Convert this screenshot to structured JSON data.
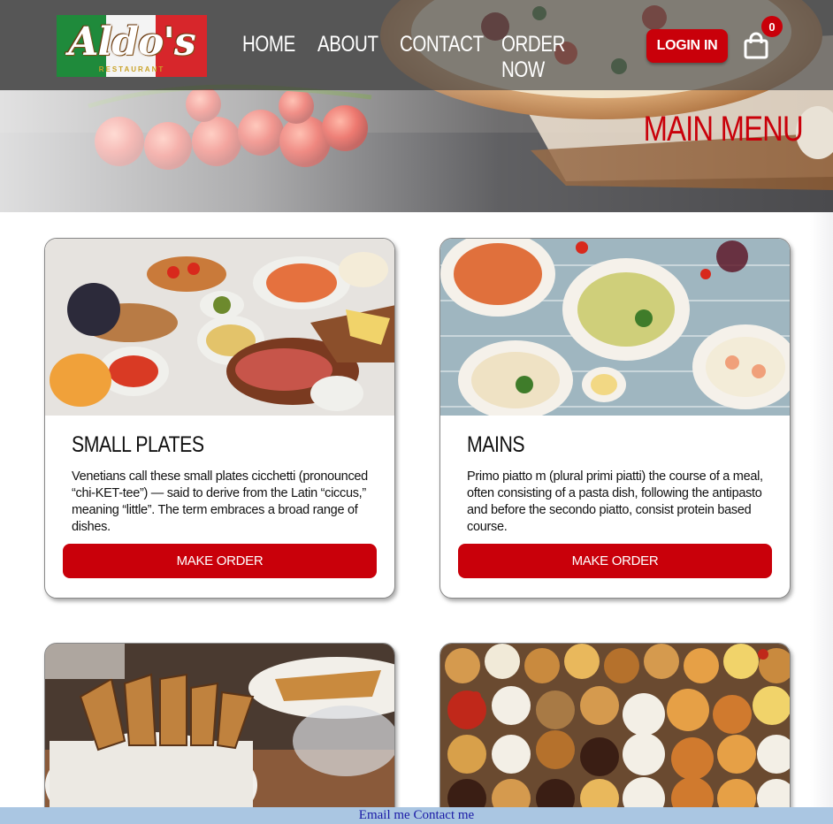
{
  "brand": {
    "logo_text": "Aldo's",
    "logo_subtitle": "RESTAURANT"
  },
  "nav": {
    "items": [
      "HOME",
      "ABOUT",
      "CONTACT",
      "ORDER NOW"
    ],
    "login_label": "LOGIN IN",
    "cart_count": "0"
  },
  "hero": {
    "title": "MAIN MENU"
  },
  "menu": {
    "cards": [
      {
        "title": "SMALL PLATES",
        "description": "Venetians call these small plates cicchetti (pronounced “chi-KET-tee”) — said to derive from the Latin “ciccus,” meaning “little”. The term embraces a broad range of dishes.",
        "button_label": "MAKE ORDER"
      },
      {
        "title": "MAINS",
        "description": "Primo piatto m (plural primi piatti) the course of a meal, often consisting of a pasta dish, following the antipasto and before the secondo piatto, consist protein based course.",
        "button_label": "MAKE ORDER"
      },
      {
        "title": "",
        "description": "",
        "button_label": ""
      },
      {
        "title": "",
        "description": "",
        "button_label": ""
      }
    ]
  },
  "footer": {
    "email_link": "Email me",
    "contact_link": "Contact me"
  },
  "colors": {
    "brand_red": "#c9000a",
    "nav_overlay": "#555555",
    "footer_bg": "#aac6e2",
    "link_blue": "#1a1aa6"
  }
}
